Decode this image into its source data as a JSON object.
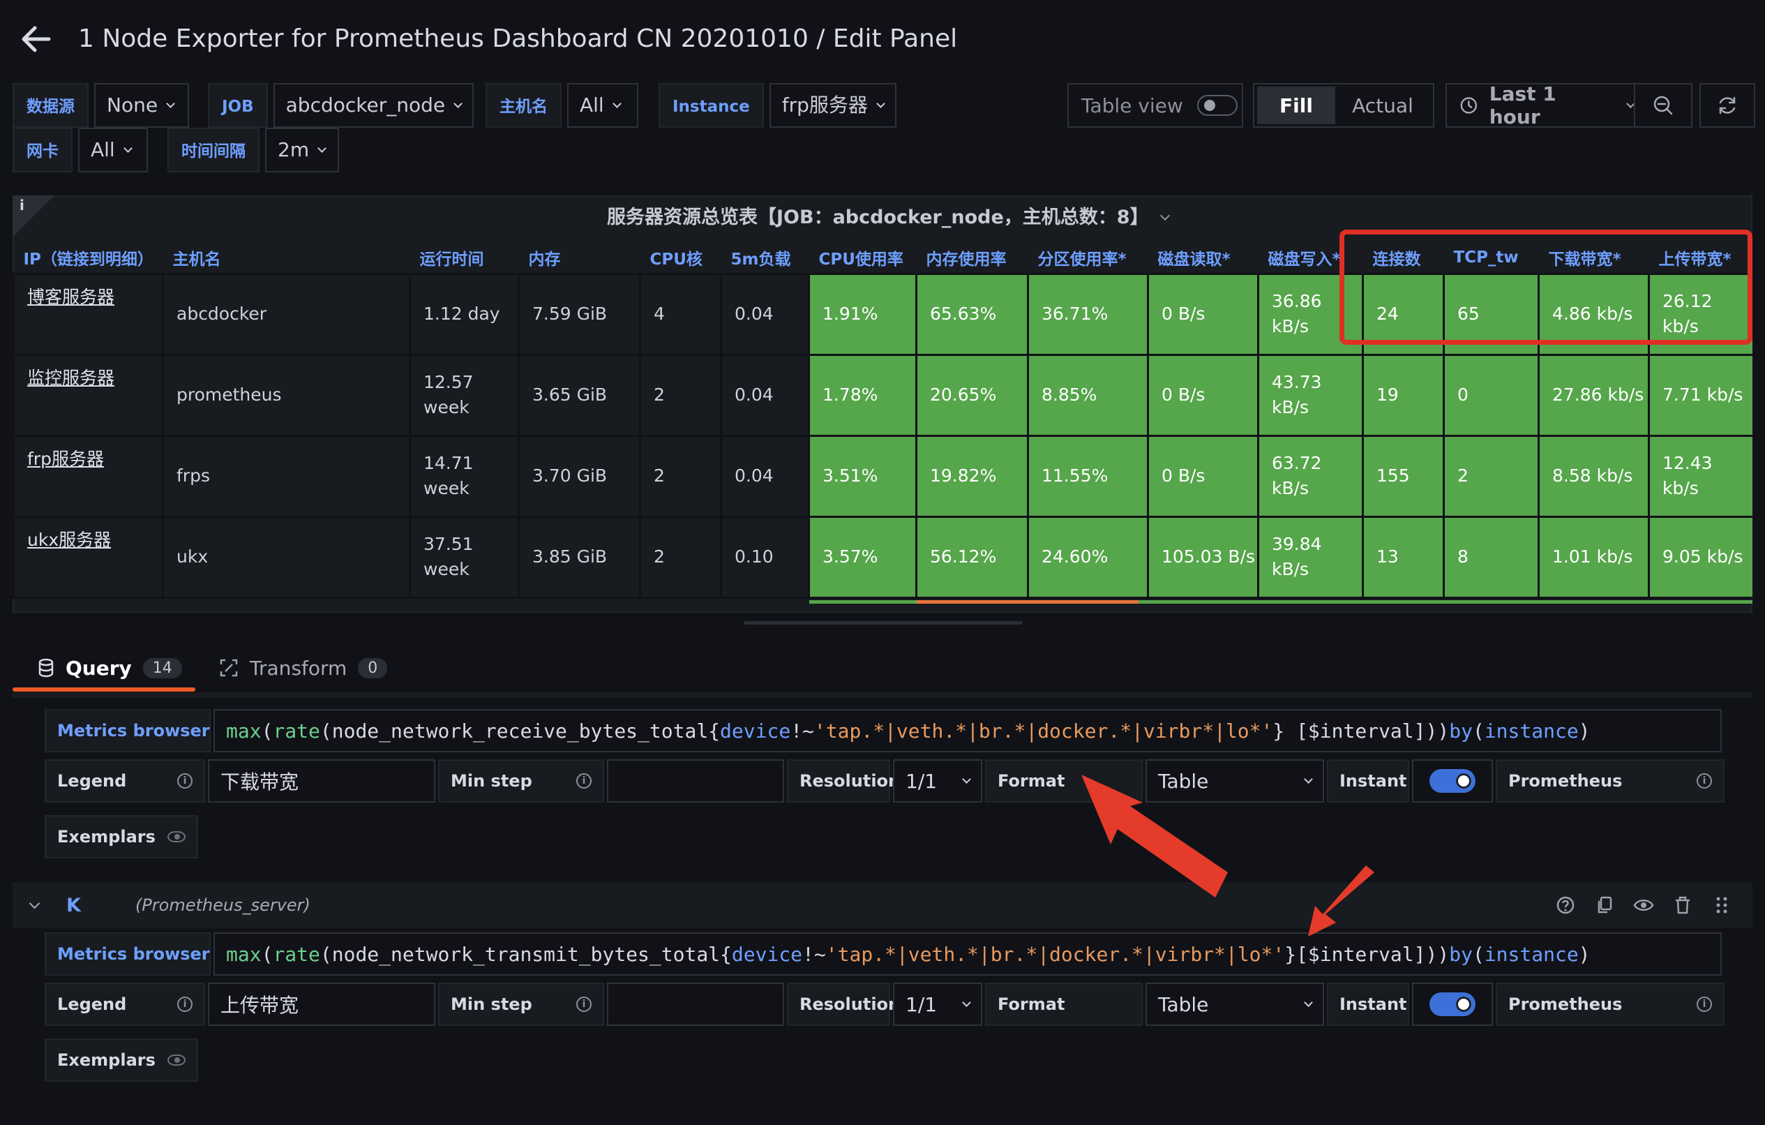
{
  "header": {
    "title": "1 Node Exporter for Prometheus Dashboard CN 20201010 / Edit Panel"
  },
  "variables": [
    {
      "label": "数据源",
      "value": "None"
    },
    {
      "label": "JOB",
      "value": "abcdocker_node"
    },
    {
      "label": "主机名",
      "value": "All"
    },
    {
      "label": "Instance",
      "value": "frp服务器"
    },
    {
      "label": "网卡",
      "value": "All"
    },
    {
      "label": "时间间隔",
      "value": "2m"
    }
  ],
  "toolbar": {
    "table_view": "Table view",
    "fill": "Fill",
    "actual": "Actual",
    "time_range": "Last 1 hour"
  },
  "panel": {
    "info": "i",
    "title": "服务器资源总览表【JOB：abcdocker_node，主机总数：8】",
    "columns": [
      "IP（链接到明细）",
      "主机名",
      "运行时间",
      "内存",
      "CPU核",
      "5m负载",
      "CPU使用率",
      "内存使用率",
      "分区使用率*",
      "磁盘读取*",
      "磁盘写入*",
      "连接数",
      "TCP_tw",
      "下载带宽*",
      "上传带宽*"
    ],
    "rows": [
      [
        "博客服务器",
        "abcdocker",
        "1.12 day",
        "7.59 GiB",
        "4",
        "0.04",
        "1.91%",
        "65.63%",
        "36.71%",
        "0 B/s",
        "36.86 kB/s",
        "24",
        "65",
        "4.86 kb/s",
        "26.12 kb/s"
      ],
      [
        "监控服务器",
        "prometheus",
        "12.57 week",
        "3.65 GiB",
        "2",
        "0.04",
        "1.78%",
        "20.65%",
        "8.85%",
        "0 B/s",
        "43.73 kB/s",
        "19",
        "0",
        "27.86 kb/s",
        "7.71 kb/s"
      ],
      [
        "frp服务器",
        "frps",
        "14.71 week",
        "3.70 GiB",
        "2",
        "0.04",
        "3.51%",
        "19.82%",
        "11.55%",
        "0 B/s",
        "63.72 kB/s",
        "155",
        "2",
        "8.58 kb/s",
        "12.43 kb/s"
      ],
      [
        "ukx服务器",
        "ukx",
        "37.51 week",
        "3.85 GiB",
        "2",
        "0.10",
        "3.57%",
        "56.12%",
        "24.60%",
        "105.03 B/s",
        "39.84 kB/s",
        "13",
        "8",
        "1.01 kb/s",
        "9.05 kb/s"
      ]
    ]
  },
  "tabs": {
    "query_label": "Query",
    "query_count": "14",
    "transform_label": "Transform",
    "transform_count": "0"
  },
  "queries": [
    {
      "metrics_browser": "Metrics browser",
      "expr": {
        "fn1": "max",
        "fn2": "rate",
        "metric": "node_network_receive_bytes_total{",
        "label": "device",
        "op": "!~",
        "str": "'tap.*|veth.*|br.*|docker.*|virbr*|lo*'",
        "rest": "} [$interval])) ",
        "by": "by",
        "paren_open": " (",
        "group": "instance",
        "paren_close": ")"
      },
      "legend_label": "Legend",
      "legend_value": "下载带宽",
      "min_step_label": "Min step",
      "resolution_label": "Resolution",
      "resolution_value": "1/1",
      "format_label": "Format",
      "format_value": "Table",
      "instant_label": "Instant",
      "prometheus_label": "Prometheus",
      "exemplars_label": "Exemplars"
    },
    {
      "ref_id": "K",
      "datasource": "(Prometheus_server)",
      "metrics_browser": "Metrics browser",
      "expr": {
        "fn1": "max",
        "fn2": "rate",
        "metric": "node_network_transmit_bytes_total{",
        "label": "device",
        "op": "!~",
        "str": "'tap.*|veth.*|br.*|docker.*|virbr*|lo*'",
        "rest": "}[$interval])) ",
        "by": "by",
        "paren_open": " (",
        "group": "instance",
        "paren_close": ")"
      },
      "legend_label": "Legend",
      "legend_value": "上传带宽",
      "min_step_label": "Min step",
      "resolution_label": "Resolution",
      "resolution_value": "1/1",
      "format_label": "Format",
      "format_value": "Table",
      "instant_label": "Instant",
      "prometheus_label": "Prometheus",
      "exemplars_label": "Exemplars"
    }
  ],
  "colors": {
    "cell_green": "#56a64b",
    "highlight_red": "#e02f24",
    "annotation_arrow": "#e53b2a",
    "accent_blue": "#6e9fff",
    "tab_underline": "#f05a28"
  }
}
